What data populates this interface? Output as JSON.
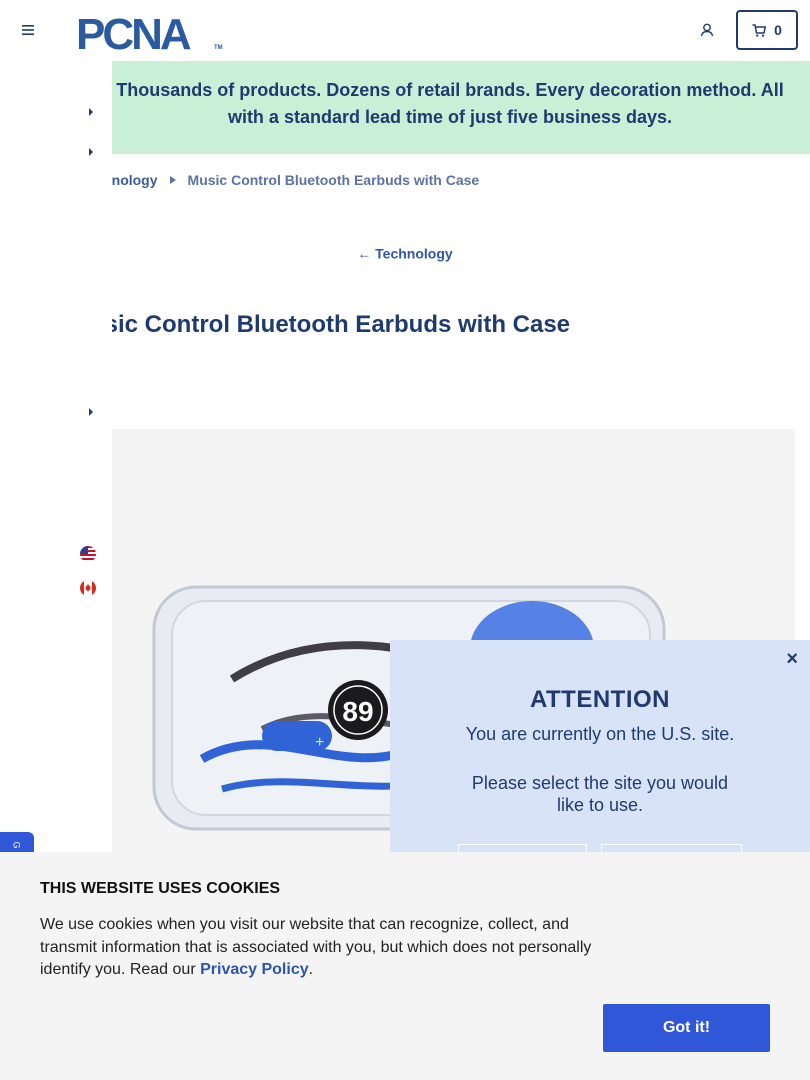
{
  "header": {
    "logo_text": "PCNA",
    "logo_tm": "TM",
    "cart_count": "0"
  },
  "banner": {
    "text": "Thousands of products. Dozens of retail brands. Every decoration method. All with a standard lead time of just five business days."
  },
  "breadcrumb": {
    "parent": "Technology",
    "current": "Music Control Bluetooth Earbuds with Case"
  },
  "back_link": {
    "arrow": "←",
    "label": "Technology"
  },
  "product": {
    "title": "Music Control Bluetooth Earbuds with Case",
    "badge_number": "89"
  },
  "attention": {
    "close": "×",
    "title": "ATTENTION",
    "line1": "You are currently on the U.S. site.",
    "line2": "Please select the site you would like to use."
  },
  "cookie": {
    "title": "THIS WEBSITE USES COOKIES",
    "text_before_link": "We use cookies when you visit our website that can recognize, collect, and transmit information that is associated with you, but which does not personally identify you. Read our ",
    "link_label": "Privacy Policy",
    "text_after_link": ".",
    "button_label": "Got it!"
  },
  "colors": {
    "brand_navy": "#1f3a6e",
    "banner_green": "#c9f0d7",
    "modal_blue": "#d8e3f7",
    "accent_blue": "#2f57d8"
  },
  "icons": {
    "menu": "hamburger-icon",
    "account": "user-icon",
    "cart": "cart-icon",
    "back": "arrow-left-icon",
    "crumb_sep": "caret-right-icon",
    "flag_us": "us-flag-icon",
    "flag_ca": "canada-flag-icon"
  }
}
